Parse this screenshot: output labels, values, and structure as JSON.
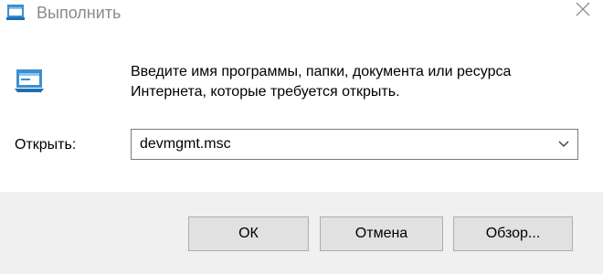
{
  "window": {
    "title": "Выполнить",
    "title_icon": "run-dialog-icon",
    "close_icon": "close-icon"
  },
  "content": {
    "icon": "run-app-icon",
    "description_line1": "Введите имя программы, папки, документа или ресурса",
    "description_line2": "Интернета, которые требуется открыть."
  },
  "open_field": {
    "label": "Открыть:",
    "value": "devmgmt.msc",
    "dropdown_icon": "chevron-down-icon"
  },
  "buttons": {
    "ok_label": "ОК",
    "cancel_label": "Отмена",
    "browse_label": "Обзор..."
  },
  "colors": {
    "accent": "#3c8fd1",
    "footer_bg": "#f0f0f0",
    "button_bg": "#e1e1e1",
    "title_text": "#8a8a8a"
  }
}
